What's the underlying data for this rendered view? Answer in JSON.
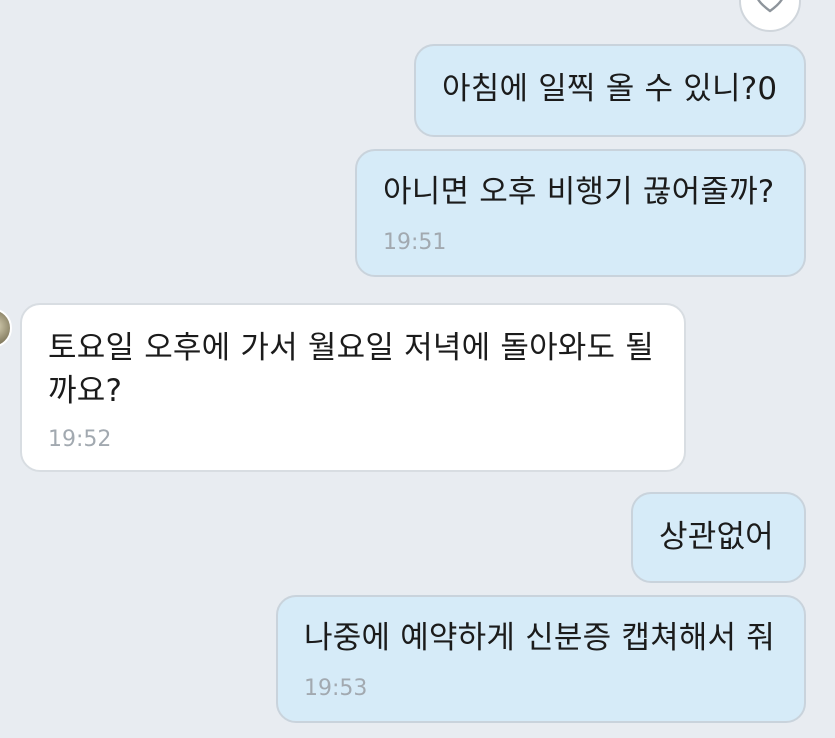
{
  "messages": [
    {
      "id": "m1",
      "direction": "outgoing",
      "text": "아침에 일찍 올 수 있니?0",
      "time": ""
    },
    {
      "id": "m2",
      "direction": "outgoing",
      "text": "아니면 오후 비행기 끊어줄까?",
      "time": "19:51"
    },
    {
      "id": "m3",
      "direction": "incoming",
      "text": "토요일 오후에 가서 월요일 저녁에 돌아와도 될까요?",
      "time": "19:52"
    },
    {
      "id": "m4",
      "direction": "outgoing",
      "text": "상관없어",
      "time": ""
    },
    {
      "id": "m5",
      "direction": "outgoing",
      "text": "나중에 예약하게 신분증 캡쳐해서 줘",
      "time": "19:53"
    }
  ],
  "colors": {
    "background": "#e8ecf1",
    "outgoing_bubble": "#d6ebf8",
    "incoming_bubble": "#ffffff",
    "timestamp": "#a2a9b0"
  },
  "icons": {
    "reaction": "heart-icon",
    "sender_avatar": "avatar"
  }
}
